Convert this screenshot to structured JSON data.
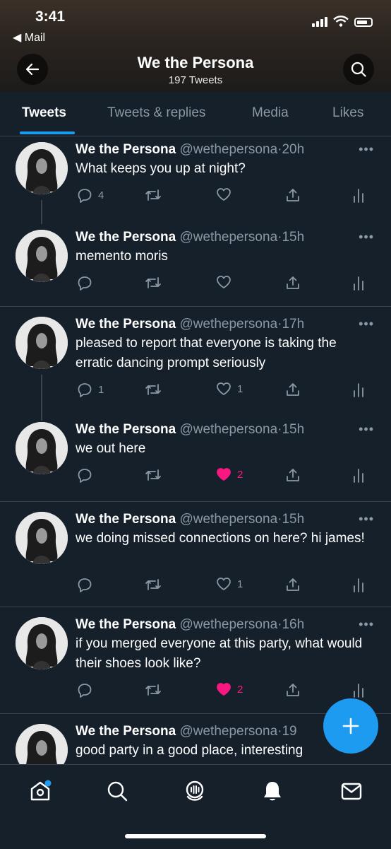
{
  "status": {
    "time": "3:41",
    "back_app": "Mail"
  },
  "header": {
    "title": "We the Persona",
    "subtitle": "197 Tweets",
    "icons": [
      "arrow-left-icon",
      "search-icon"
    ]
  },
  "tabs": [
    {
      "label": "Tweets",
      "active": true
    },
    {
      "label": "Tweets & replies",
      "active": false
    },
    {
      "label": "Media",
      "active": false
    },
    {
      "label": "Likes",
      "active": false
    }
  ],
  "tweets": [
    {
      "name": "We the Persona",
      "handle": "@wethepersona",
      "dot": "·",
      "time": "20h",
      "text": "What keeps you up at night?",
      "replies": "4",
      "retweets": "",
      "likes": "",
      "liked": false
    },
    {
      "name": "We the Persona",
      "handle": "@wethepersona",
      "dot": "·",
      "time": "15h",
      "text": "memento moris",
      "replies": "",
      "retweets": "",
      "likes": "",
      "liked": false
    },
    {
      "name": "We the Persona",
      "handle": "@wethepersona",
      "dot": "·",
      "time": "17h",
      "text": "pleased to report that everyone is taking the erratic dancing prompt seriously",
      "replies": "1",
      "retweets": "",
      "likes": "1",
      "liked": false
    },
    {
      "name": "We the Persona",
      "handle": "@wethepersona",
      "dot": "·",
      "time": "15h",
      "text": "we out here",
      "replies": "",
      "retweets": "",
      "likes": "2",
      "liked": true
    },
    {
      "name": "We the Persona",
      "handle": "@wethepersona",
      "dot": "·",
      "time": "15h",
      "text": "we doing missed connections on here? hi james!",
      "replies": "",
      "retweets": "",
      "likes": "1",
      "liked": false
    },
    {
      "name": "We the Persona",
      "handle": "@wethepersona",
      "dot": "·",
      "time": "16h",
      "text": "if you merged everyone at this party, what would their shoes look like?",
      "replies": "",
      "retweets": "",
      "likes": "2",
      "liked": true
    },
    {
      "name": "We the Persona",
      "handle": "@wethepersona",
      "dot": "·",
      "time": "19",
      "text": "good party in a good place, interesting",
      "replies": "",
      "retweets": "",
      "likes": "",
      "liked": false
    }
  ],
  "more_label": "•••",
  "bottom_nav": [
    "home-icon",
    "search-icon",
    "spaces-icon",
    "notifications-icon",
    "messages-icon"
  ],
  "colors": {
    "background": "#15202b",
    "accent": "#1d9bf0",
    "like": "#f91880",
    "muted": "#8b98a5",
    "divider": "#38444d"
  }
}
